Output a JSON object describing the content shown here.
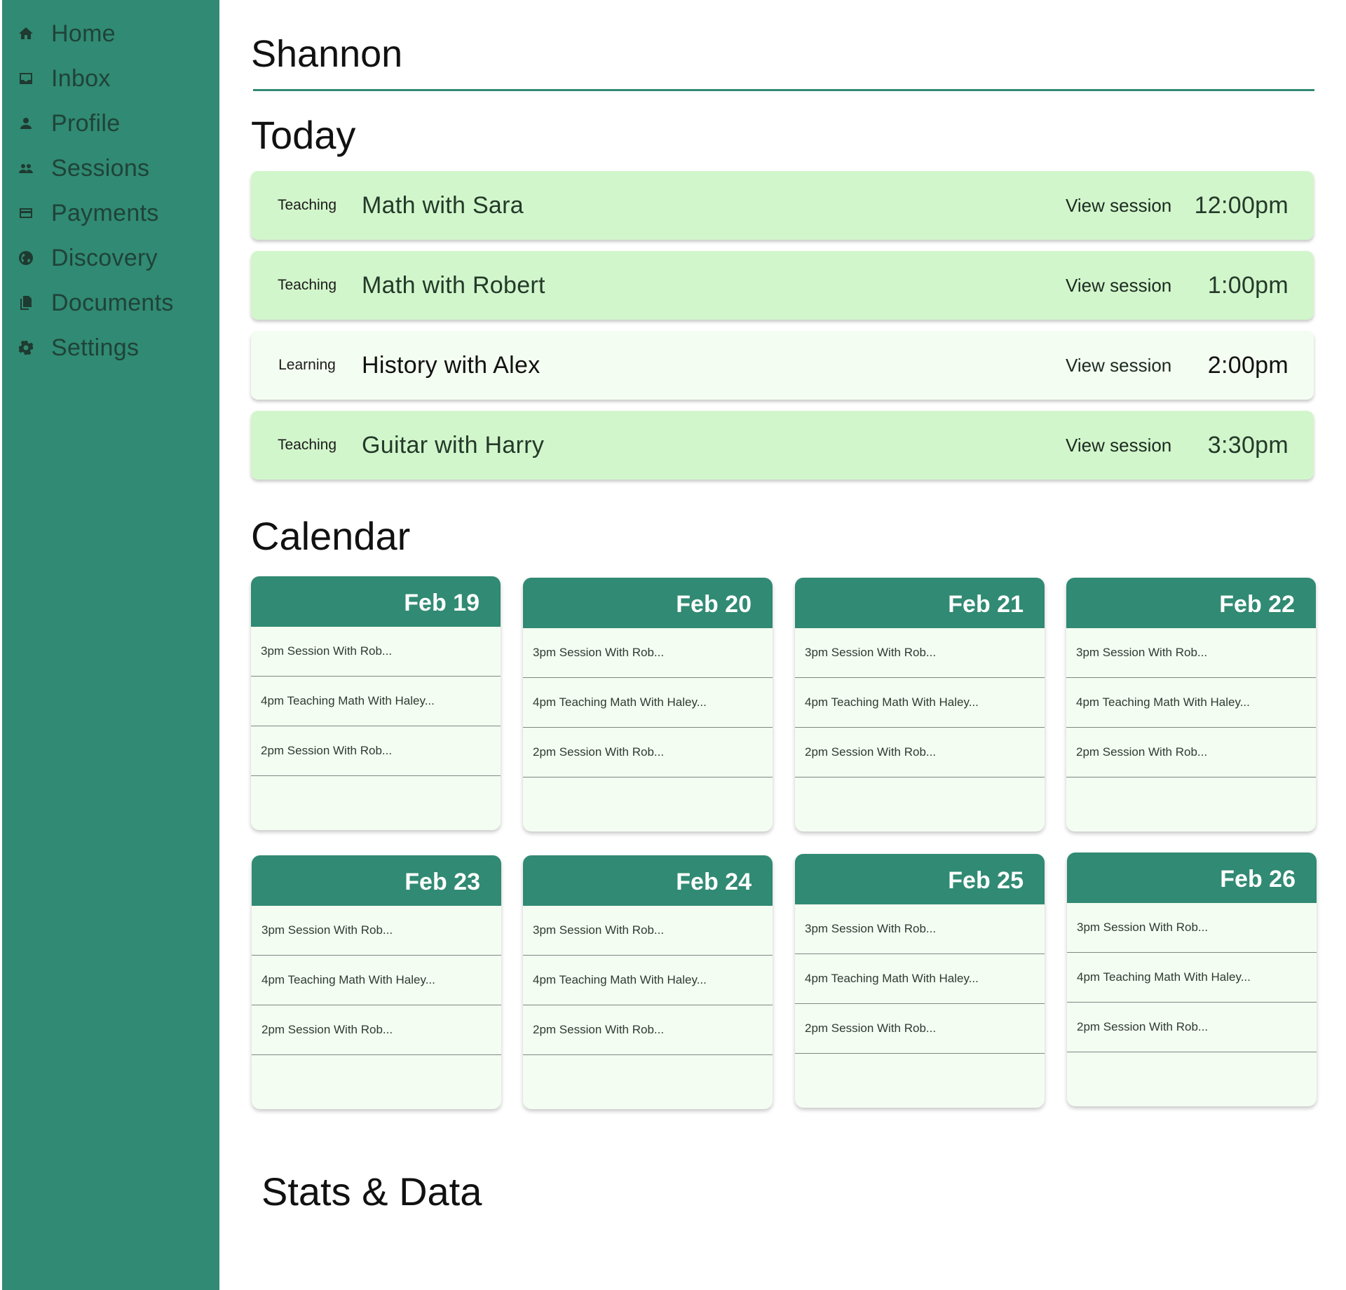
{
  "sidebar": {
    "items": [
      {
        "label": "Home",
        "icon": "home-icon"
      },
      {
        "label": "Inbox",
        "icon": "inbox-icon"
      },
      {
        "label": "Profile",
        "icon": "person-icon"
      },
      {
        "label": "Sessions",
        "icon": "people-icon"
      },
      {
        "label": "Payments",
        "icon": "credit-card-icon"
      },
      {
        "label": "Discovery",
        "icon": "globe-icon"
      },
      {
        "label": "Documents",
        "icon": "documents-icon"
      },
      {
        "label": "Settings",
        "icon": "gear-icon"
      }
    ]
  },
  "header": {
    "title": "Shannon"
  },
  "today": {
    "title": "Today",
    "sessions": [
      {
        "type": "Teaching",
        "title": "Math with Sara",
        "action": "View session",
        "time": "12:00pm"
      },
      {
        "type": "Teaching",
        "title": "Math with Robert",
        "action": "View session",
        "time": "1:00pm"
      },
      {
        "type": "Learning",
        "title": "History with Alex",
        "action": "View session",
        "time": "2:00pm"
      },
      {
        "type": "Teaching",
        "title": "Guitar with Harry",
        "action": "View session",
        "time": "3:30pm"
      }
    ]
  },
  "calendar": {
    "title": "Calendar",
    "days": [
      {
        "date": "Feb 19",
        "events": [
          "3pm Session With Rob...",
          "4pm Teaching Math With Haley...",
          "2pm Session With Rob..."
        ]
      },
      {
        "date": "Feb 20",
        "events": [
          "3pm Session With Rob...",
          "4pm Teaching Math With Haley...",
          "2pm Session With Rob..."
        ]
      },
      {
        "date": "Feb 21",
        "events": [
          "3pm Session With Rob...",
          "4pm Teaching Math With Haley...",
          "2pm Session With Rob..."
        ]
      },
      {
        "date": "Feb 22",
        "events": [
          "3pm Session With Rob...",
          "4pm Teaching Math With Haley...",
          "2pm Session With Rob..."
        ]
      },
      {
        "date": "Feb 23",
        "events": [
          "3pm Session With Rob...",
          "4pm Teaching Math With Haley...",
          "2pm Session With Rob..."
        ]
      },
      {
        "date": "Feb 24",
        "events": [
          "3pm Session With Rob...",
          "4pm Teaching Math With Haley...",
          "2pm Session With Rob..."
        ]
      },
      {
        "date": "Feb 25",
        "events": [
          "3pm Session With Rob...",
          "4pm Teaching Math With Haley...",
          "2pm Session With Rob..."
        ]
      },
      {
        "date": "Feb 26",
        "events": [
          "3pm Session With Rob...",
          "4pm Teaching Math With Haley...",
          "2pm Session With Rob..."
        ]
      }
    ]
  },
  "stats": {
    "title": "Stats & Data"
  },
  "colors": {
    "sidebar": "#318a73",
    "accent": "#318a73",
    "teaching_bg": "#d2f6cb",
    "learning_bg": "#f4fdf1",
    "calendar_bg": "#f4fdf1"
  }
}
